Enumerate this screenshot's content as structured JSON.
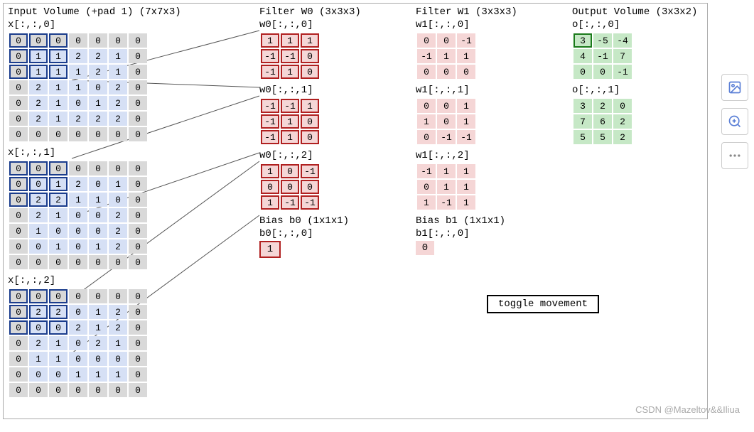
{
  "headers": {
    "input": "Input Volume (+pad 1) (7x7x3)",
    "w0": "Filter W0 (3x3x3)",
    "w1": "Filter W1 (3x3x3)",
    "out": "Output Volume (3x3x2)"
  },
  "labels": {
    "x0": "x[:,:,0]",
    "x1": "x[:,:,1]",
    "x2": "x[:,:,2]",
    "w00": "w0[:,:,0]",
    "w01": "w0[:,:,1]",
    "w02": "w0[:,:,2]",
    "w10": "w1[:,:,0]",
    "w11": "w1[:,:,1]",
    "w12": "w1[:,:,2]",
    "o0": "o[:,:,0]",
    "o1": "o[:,:,1]",
    "b0h": "Bias b0 (1x1x1)",
    "b0l": "b0[:,:,0]",
    "b1h": "Bias b1 (1x1x1)",
    "b1l": "b1[:,:,0]"
  },
  "input": {
    "x0": [
      [
        0,
        0,
        0,
        0,
        0,
        0,
        0
      ],
      [
        0,
        1,
        1,
        2,
        2,
        1,
        0
      ],
      [
        0,
        1,
        1,
        1,
        2,
        1,
        0
      ],
      [
        0,
        2,
        1,
        1,
        0,
        2,
        0
      ],
      [
        0,
        2,
        1,
        0,
        1,
        2,
        0
      ],
      [
        0,
        2,
        1,
        2,
        2,
        2,
        0
      ],
      [
        0,
        0,
        0,
        0,
        0,
        0,
        0
      ]
    ],
    "x1": [
      [
        0,
        0,
        0,
        0,
        0,
        0,
        0
      ],
      [
        0,
        0,
        1,
        2,
        0,
        1,
        0
      ],
      [
        0,
        2,
        2,
        1,
        1,
        0,
        0
      ],
      [
        0,
        2,
        1,
        0,
        0,
        2,
        0
      ],
      [
        0,
        1,
        0,
        0,
        0,
        2,
        0
      ],
      [
        0,
        0,
        1,
        0,
        1,
        2,
        0
      ],
      [
        0,
        0,
        0,
        0,
        0,
        0,
        0
      ]
    ],
    "x2": [
      [
        0,
        0,
        0,
        0,
        0,
        0,
        0
      ],
      [
        0,
        2,
        2,
        0,
        1,
        2,
        0
      ],
      [
        0,
        0,
        0,
        2,
        1,
        2,
        0
      ],
      [
        0,
        2,
        1,
        0,
        2,
        1,
        0
      ],
      [
        0,
        1,
        1,
        0,
        0,
        0,
        0
      ],
      [
        0,
        0,
        0,
        1,
        1,
        1,
        0
      ],
      [
        0,
        0,
        0,
        0,
        0,
        0,
        0
      ]
    ]
  },
  "highlight": {
    "r0": 0,
    "r1": 2,
    "c0": 0,
    "c1": 2
  },
  "w0": {
    "d0": [
      [
        1,
        1,
        1
      ],
      [
        -1,
        -1,
        0
      ],
      [
        -1,
        1,
        0
      ]
    ],
    "d1": [
      [
        -1,
        -1,
        1
      ],
      [
        -1,
        1,
        0
      ],
      [
        -1,
        1,
        0
      ]
    ],
    "d2": [
      [
        1,
        0,
        -1
      ],
      [
        0,
        0,
        0
      ],
      [
        1,
        -1,
        -1
      ]
    ]
  },
  "w1": {
    "d0": [
      [
        0,
        0,
        -1
      ],
      [
        -1,
        1,
        1
      ],
      [
        0,
        0,
        0
      ]
    ],
    "d1": [
      [
        0,
        0,
        1
      ],
      [
        1,
        0,
        1
      ],
      [
        0,
        -1,
        -1
      ]
    ],
    "d2": [
      [
        -1,
        1,
        1
      ],
      [
        0,
        1,
        1
      ],
      [
        1,
        -1,
        1
      ]
    ]
  },
  "bias": {
    "b0": 1,
    "b1": 0
  },
  "output": {
    "o0": [
      [
        3,
        -5,
        -4
      ],
      [
        4,
        -1,
        7
      ],
      [
        0,
        0,
        -1
      ]
    ],
    "o1": [
      [
        3,
        2,
        0
      ],
      [
        7,
        6,
        2
      ],
      [
        5,
        5,
        2
      ]
    ]
  },
  "output_current": {
    "slice": 0,
    "r": 0,
    "c": 0
  },
  "toggle_label": "toggle movement",
  "watermark": "CSDN @Mazeltov&&Iliua"
}
